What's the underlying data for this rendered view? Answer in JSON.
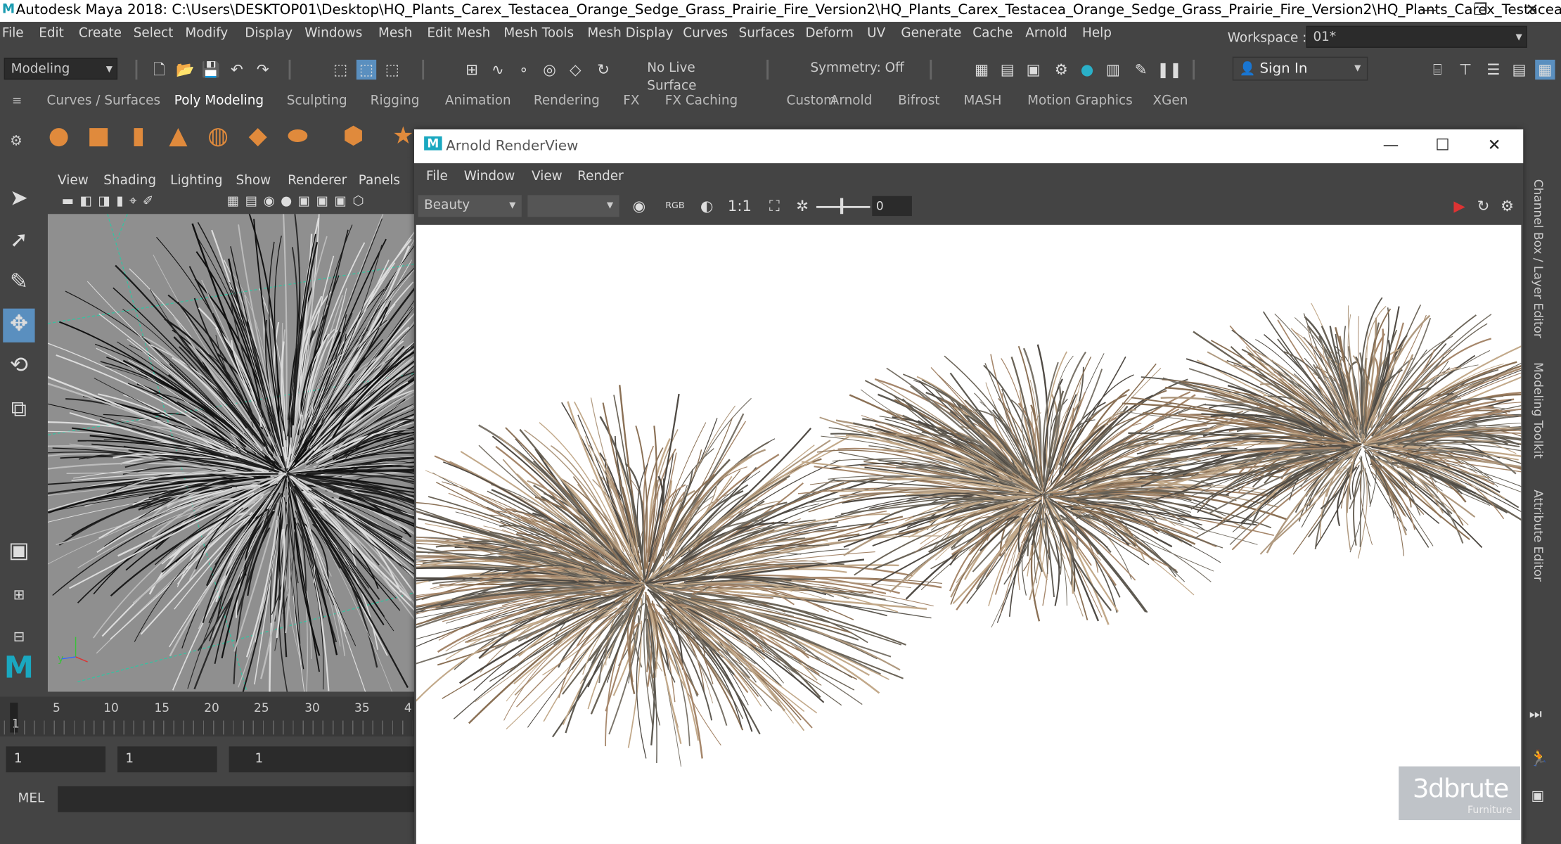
{
  "titlebar": {
    "app_icon": "maya-icon",
    "title": "Autodesk Maya 2018: C:\\Users\\DESKTOP01\\Desktop\\HQ_Plants_Carex_Testacea_Orange_Sedge_Grass_Prairie_Fire_Version2\\HQ_Plants_Carex_Testacea_Orange_Sedge_Grass_Prairie_Fire_Version2\\HQ_Plants_Carex_Testacea_Orang...",
    "minimize": "—",
    "maximize": "❐",
    "close": "✕"
  },
  "menubar": [
    "File",
    "Edit",
    "Create",
    "Select",
    "Modify",
    "Display",
    "Windows",
    "Mesh",
    "Edit Mesh",
    "Mesh Tools",
    "Mesh Display",
    "Curves",
    "Surfaces",
    "Deform",
    "UV",
    "Generate",
    "Cache",
    "Arnold",
    "Help"
  ],
  "workspace": {
    "label": "Workspace :",
    "value": "01*"
  },
  "statusline": {
    "mode": "Modeling",
    "live_surface": "No Live Surface",
    "symmetry": "Symmetry: Off",
    "sign_in": "Sign In"
  },
  "shelf_tabs": [
    "Curves / Surfaces",
    "Poly Modeling",
    "Sculpting",
    "Rigging",
    "Animation",
    "Rendering",
    "FX",
    "FX Caching",
    "Custom",
    "Arnold",
    "Bifrost",
    "MASH",
    "Motion Graphics",
    "XGen"
  ],
  "shelf_active": "Poly Modeling",
  "viewport": {
    "menu": [
      "View",
      "Shading",
      "Lighting",
      "Show",
      "Renderer",
      "Panels"
    ]
  },
  "timeline": {
    "ticks": [
      "5",
      "10",
      "15",
      "20",
      "25",
      "30",
      "35",
      "4"
    ],
    "current": "1"
  },
  "range": {
    "start": "1",
    "start2": "1",
    "current": "1"
  },
  "cmdline": {
    "label": "MEL"
  },
  "renderview": {
    "title": "Arnold RenderView",
    "menu": [
      "File",
      "Window",
      "View",
      "Render"
    ],
    "aov": "Beauty",
    "zoom": "1:1",
    "exposure": "0",
    "minimize": "—",
    "maximize": "☐",
    "close": "✕"
  },
  "right_tabs": [
    "Channel Box / Layer Editor",
    "Modeling Toolkit",
    "Attribute Editor"
  ],
  "watermark": {
    "brand": "3dbrute",
    "sub": "Furniture",
    "accent": "#2a8fd6"
  },
  "colors": {
    "shelf_icon": "#e08a3c",
    "active_tool": "#5a8fbf",
    "grid": "#3bbfa0"
  }
}
